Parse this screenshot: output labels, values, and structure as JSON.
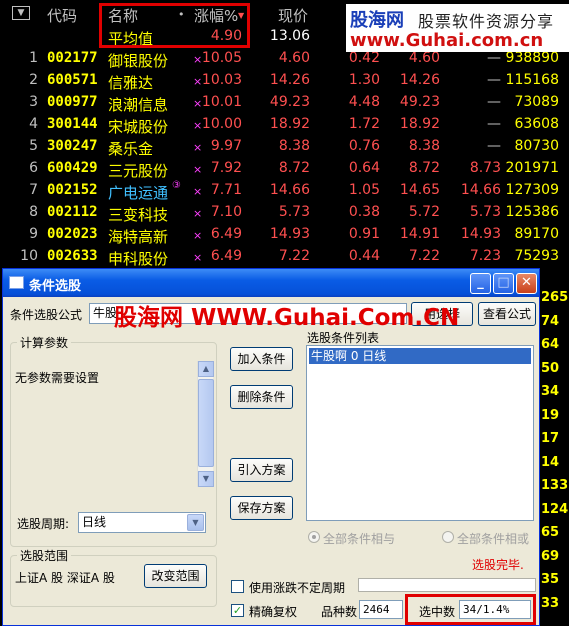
{
  "grid": {
    "headers": {
      "code": "代码",
      "name": "名称",
      "dot": "•",
      "pct": "涨幅%",
      "price": "现价"
    },
    "avg": {
      "label": "平均值",
      "pct": "4.90",
      "price": "13.06"
    },
    "rows": [
      {
        "idx": "1",
        "code": "002177",
        "name": "御银股份",
        "pct": "10.05",
        "price": "4.60",
        "chg": "0.42",
        "buy": "4.60",
        "sell": "—",
        "vol": "938890"
      },
      {
        "idx": "2",
        "code": "600571",
        "name": "信雅达",
        "pct": "10.03",
        "price": "14.26",
        "chg": "1.30",
        "buy": "14.26",
        "sell": "—",
        "vol": "115168"
      },
      {
        "idx": "3",
        "code": "000977",
        "name": "浪潮信息",
        "pct": "10.01",
        "price": "49.23",
        "chg": "4.48",
        "buy": "49.23",
        "sell": "—",
        "vol": "73089"
      },
      {
        "idx": "4",
        "code": "300144",
        "name": "宋城股份",
        "pct": "10.00",
        "price": "18.92",
        "chg": "1.72",
        "buy": "18.92",
        "sell": "—",
        "vol": "63608"
      },
      {
        "idx": "5",
        "code": "300247",
        "name": "桑乐金",
        "pct": "9.97",
        "price": "8.38",
        "chg": "0.76",
        "buy": "8.38",
        "sell": "—",
        "vol": "80730"
      },
      {
        "idx": "6",
        "code": "600429",
        "name": "三元股份",
        "pct": "7.92",
        "price": "8.72",
        "chg": "0.64",
        "buy": "8.72",
        "sell": "8.73",
        "vol": "201971"
      },
      {
        "idx": "7",
        "code": "002152",
        "name": "广电运通",
        "pct": "7.71",
        "price": "14.66",
        "chg": "1.05",
        "buy": "14.65",
        "sell": "14.66",
        "vol": "127309",
        "mark": "③"
      },
      {
        "idx": "8",
        "code": "002112",
        "name": "三变科技",
        "pct": "7.10",
        "price": "5.73",
        "chg": "0.38",
        "buy": "5.72",
        "sell": "5.73",
        "vol": "125386"
      },
      {
        "idx": "9",
        "code": "002023",
        "name": "海特高新",
        "pct": "6.49",
        "price": "14.93",
        "chg": "0.91",
        "buy": "14.91",
        "sell": "14.93",
        "vol": "89170"
      },
      {
        "idx": "10",
        "code": "002633",
        "name": "申科股份",
        "pct": "6.49",
        "price": "7.22",
        "chg": "0.44",
        "buy": "7.22",
        "sell": "7.23",
        "vol": "75293"
      }
    ],
    "x_mark": "×",
    "side_values": [
      "265",
      "74",
      "64",
      "50",
      "34",
      "19",
      "17",
      "14",
      "133",
      "124",
      "65",
      "69",
      "35",
      "33"
    ]
  },
  "watermark": {
    "brand": "股海网",
    "slogan": "股票软件资源分享",
    "url": "www.Guhai.com.cn",
    "mid": "股海网 WWW.Guhai.Com.CN"
  },
  "dialog": {
    "title": "条件选股",
    "formula_label": "条件选股公式",
    "formula_value": "牛股",
    "btn_select": "用选择",
    "btn_view": "查看公式",
    "params_title": "计算参数",
    "params_text": "无参数需要设置",
    "btn_add": "加入条件",
    "btn_delete": "删除条件",
    "list_title": "选股条件列表",
    "list_items": [
      "牛股啊  0  日线"
    ],
    "btn_import": "引入方案",
    "btn_save": "保存方案",
    "period_label": "选股周期:",
    "period_value": "日线",
    "radio_and": "全部条件相与",
    "radio_or": "全部条件相或",
    "status": "选股完毕.",
    "range_title": "选股范围",
    "range_text": "上证A 股  深证A 股",
    "btn_range": "改变范围",
    "cb_uncertain": "使用涨跌不定周期",
    "cb_exact": "精确复权",
    "count_label": "品种数",
    "count_value": "2464",
    "selected_label": "选中数",
    "selected_value": "34/1.4%"
  },
  "colors": {
    "code": "#ffff00",
    "rise": "#ff5050",
    "highlight_box": "#e00000"
  }
}
